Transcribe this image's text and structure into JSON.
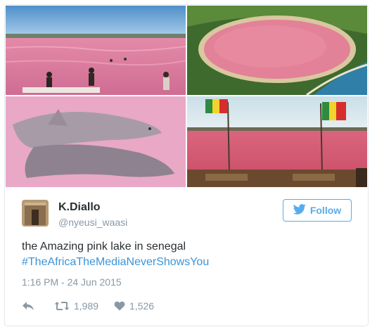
{
  "tweet": {
    "author_name": "K.Diallo",
    "author_handle": "@nyeusi_waasi",
    "follow_label": "Follow",
    "text": "the Amazing pink lake in senegal",
    "hashtag": "#TheAfricaTheMediaNeverShowsYou",
    "timestamp": "1:16 PM - 24 Jun 2015",
    "retweet_count": "1,989",
    "like_count": "1,526"
  },
  "colors": {
    "brand_blue": "#55acee",
    "link_blue": "#3b94d9",
    "text": "#292f33",
    "muted": "#8899a6",
    "lake_pink": "#e87d98"
  },
  "icons": [
    "twitter-bird-icon",
    "reply-icon",
    "retweet-icon",
    "heart-icon"
  ]
}
